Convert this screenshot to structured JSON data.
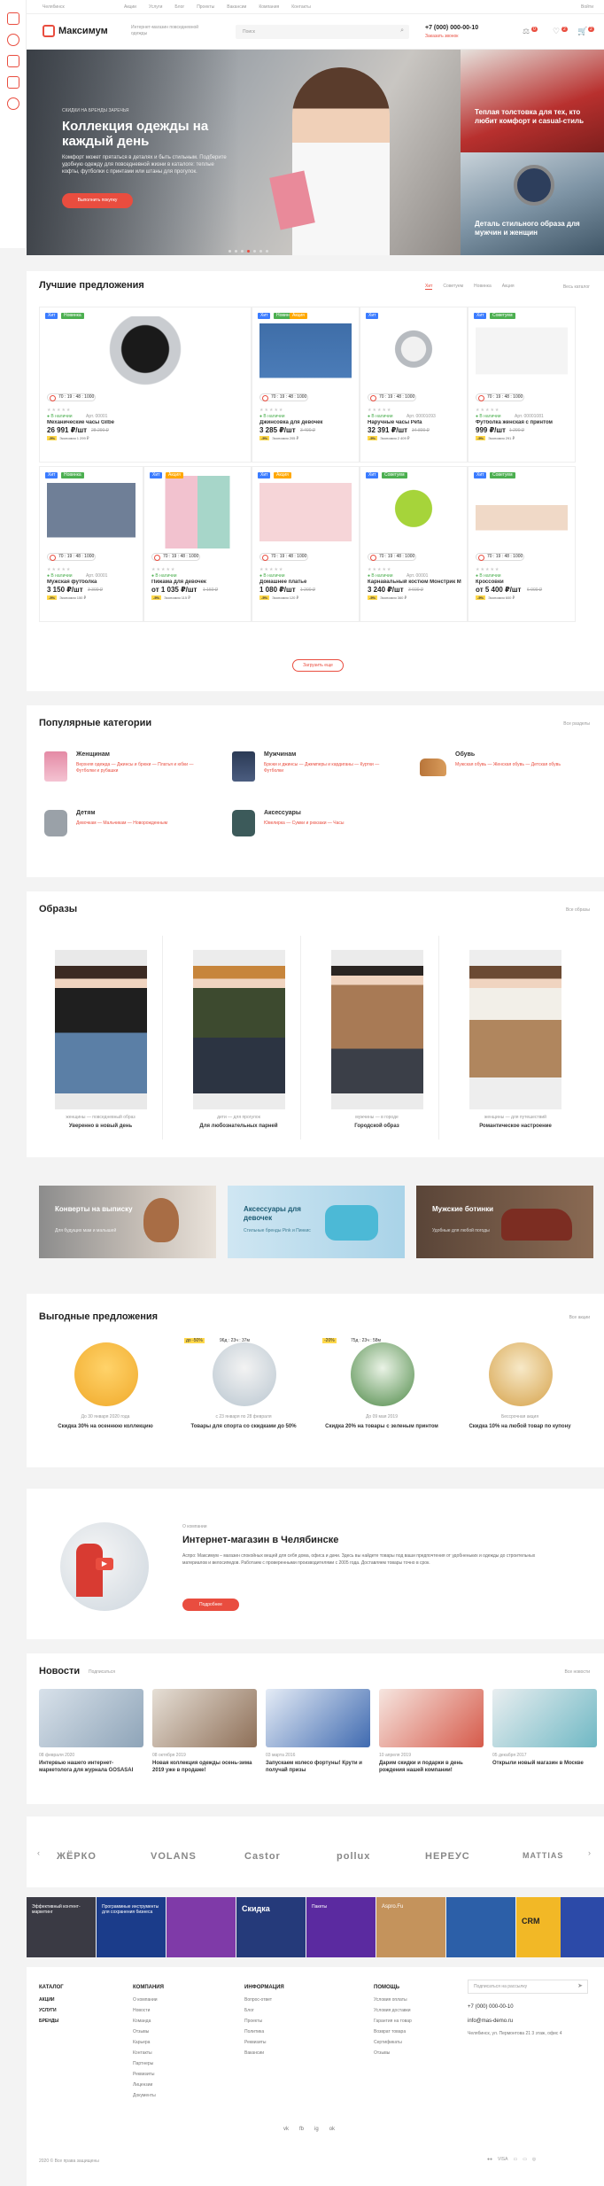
{
  "colors": {
    "accent": "#e94d3f",
    "background": "#f3f3f3",
    "panel": "#ffffff",
    "badge_hit": "#3b7cff",
    "badge_new": "#4caf50",
    "badge_advice": "#4caf50",
    "badge_sale": "#ffa800"
  },
  "topbar": {
    "city": "Челябинск",
    "links": [
      "Акции",
      "Услуги",
      "Блог",
      "Проекты",
      "Вакансии",
      "Компания",
      "Контакты"
    ],
    "login": "Войти"
  },
  "header": {
    "logo": "Максимум",
    "tagline": "Интернет-магазин повседневной одежды",
    "search_placeholder": "Поиск",
    "phone": "+7 (000) 000-00-10",
    "callback": "Заказать звонок",
    "cart_count": "2",
    "fav_count": "2",
    "compare_count": "0"
  },
  "hero": {
    "kicker": "СКИДКИ НА БРЕНДЫ ЗАРЕЧЬЯ",
    "title": "Коллекция одежды на каждый день",
    "text": "Комфорт может прятаться в деталях и быть стильным. Подберите удобную одежду для повседневной жизни в каталоге: теплые кофты, футболки с принтами или штаны для прогулок.",
    "button": "Выполнить покупку",
    "side1": "Теплая толстовка для тех, кто любит комфорт и casual-стиль",
    "side2": "Деталь стильного образа для мужчин и женщин"
  },
  "offers": {
    "title": "Лучшие предложения",
    "tabs": [
      "Хит",
      "Советуем",
      "Новинка",
      "Акция"
    ],
    "all": "Весь каталог",
    "more": "Загрузить еще",
    "products": [
      {
        "name": "Механические часы Gilbe",
        "price": "26 991 ₽/шт",
        "old": "28 290 ₽",
        "save": "1 299 ₽",
        "save_label": "Экономия",
        "badges": [
          "Хит",
          "Новинка"
        ],
        "timer": "70 : 19 : 48 : 1000",
        "stock": "В наличии",
        "art": "Арт. 00001"
      },
      {
        "name": "Джинсовка для девочек",
        "price": "3 285 ₽/шт",
        "old": "3 490 ₽",
        "save": "205 ₽",
        "save_label": "Экономия",
        "badges": [
          "Хит",
          "Новинка",
          "Акция"
        ],
        "timer": "70 : 19 : 48 : 1000",
        "stock": "В наличии",
        "art": ""
      },
      {
        "name": "Наручные часы Pefa",
        "price": "32 391 ₽/шт",
        "old": "34 800 ₽",
        "save": "2 409 ₽",
        "save_label": "Экономия",
        "badges": [
          "Хит"
        ],
        "timer": "70 : 19 : 48 : 1000",
        "stock": "В наличии",
        "art": "Арт. 00001093"
      },
      {
        "name": "Футболка женская с принтом",
        "price": "999 ₽/шт",
        "old": "1 290 ₽",
        "save": "291 ₽",
        "save_label": "Экономия",
        "badges": [
          "Хит",
          "Советуем"
        ],
        "timer": "70 : 19 : 48 : 1000",
        "stock": "В наличии",
        "art": "Арт. 00001081"
      },
      {
        "name": "Мужская футболка",
        "price": "3 150 ₽/шт",
        "old": "3 300 ₽",
        "save": "150 ₽",
        "save_label": "Экономия",
        "badges": [
          "Хит",
          "Новинка"
        ],
        "timer": "70 : 19 : 48 : 1000",
        "stock": "В наличии",
        "art": "Арт. 00001"
      },
      {
        "name": "Пижама для девочек",
        "price": "от 1 035 ₽/шт",
        "old": "1 150 ₽",
        "save": "115 ₽",
        "save_label": "Экономия",
        "badges": [
          "Хит",
          "Акция"
        ],
        "timer": "70 : 19 : 48 : 1000",
        "stock": "В наличии",
        "art": ""
      },
      {
        "name": "Домашнее платье",
        "price": "1 080 ₽/шт",
        "old": "1 200 ₽",
        "save": "120 ₽",
        "save_label": "Экономия",
        "badges": [
          "Хит",
          "Акция"
        ],
        "timer": "70 : 19 : 48 : 1000",
        "stock": "В наличии",
        "art": ""
      },
      {
        "name": "Карнавальный костюм Монстрик Майк",
        "price": "3 240 ₽/шт",
        "old": "3 600 ₽",
        "save": "360 ₽",
        "save_label": "Экономия",
        "badges": [
          "Хит",
          "Советуем"
        ],
        "timer": "70 : 19 : 48 : 1000",
        "stock": "В наличии",
        "art": "Арт. 00001"
      },
      {
        "name": "Кроссовки",
        "price": "от 5 400 ₽/шт",
        "old": "6 000 ₽",
        "save": "600 ₽",
        "save_label": "Экономия",
        "badges": [
          "Хит",
          "Советуем"
        ],
        "timer": "70 : 19 : 48 : 1000",
        "stock": "В наличии",
        "art": ""
      }
    ]
  },
  "categories": {
    "title": "Популярные категории",
    "all": "Все разделы",
    "items": [
      {
        "name": "Женщинам",
        "links": "Верхняя одежда — Джинсы и брюки — Платья и юбки — Футболки и рубашки"
      },
      {
        "name": "Мужчинам",
        "links": "Брюки и джинсы — Джемперы и кардиганы — Куртки — Футболки"
      },
      {
        "name": "Обувь",
        "links": "Мужская обувь — Женская обувь — Детская обувь"
      },
      {
        "name": "Детям",
        "links": "Девочкам — Мальчикам — Новорожденным"
      },
      {
        "name": "Аксессуары",
        "links": "Ювелирка — Сумки и рюкзаки — Часы"
      }
    ]
  },
  "outfits": {
    "title": "Образы",
    "all": "Все образы",
    "items": [
      {
        "tag": "женщины — повседневный образ",
        "name": "Уверенно в новый день"
      },
      {
        "tag": "дети — для прогулок",
        "name": "Для любознательных парней"
      },
      {
        "tag": "мужчины — в городе",
        "name": "Городской образ"
      },
      {
        "tag": "женщины — для путешествий",
        "name": "Романтическое настроение"
      }
    ]
  },
  "banners": [
    {
      "title": "Конверты на выписку",
      "sub": "Для будущих мам и малышей"
    },
    {
      "title": "Аксессуары для девочек",
      "sub": "Стильные бренды Pink и Пинкис"
    },
    {
      "title": "Мужские ботинки",
      "sub": "Удобные для любой погоды"
    }
  ],
  "deals": {
    "title": "Выгодные предложения",
    "all": "Все акции",
    "items": [
      {
        "date": "До 30 января 2020 года",
        "name": "Скидка 30% на осеннюю коллекцию",
        "tag": "",
        "timer": ""
      },
      {
        "date": "с 23 января по 28 февраля",
        "name": "Товары для спорта со скидками до 50%",
        "tag": "до -50%",
        "timer": "96д : 23ч : 37м"
      },
      {
        "date": "До 09 мая 2019",
        "name": "Скидка 20% на товары с зеленым принтом",
        "tag": "-20%",
        "timer": "75д : 23ч : 58м"
      },
      {
        "date": "Бессрочная акция",
        "name": "Скидка 10% на любой товар по купону",
        "tag": "",
        "timer": ""
      }
    ]
  },
  "about": {
    "kicker": "О компании",
    "title": "Интернет-магазин в Челябинске",
    "text": "Аспро: Максимум – магазин спокойных вещей для себя дома, офиса и дачи. Здесь вы найдете товары под ваши предпочтения от удобненьких и одежды до строительных материалов и велосипедов. Работаем с проверенными производителями с 2005 года. Доставляем товары точно в срок.",
    "button": "Подробнее"
  },
  "news": {
    "title": "Новости",
    "subscribe": "Подписаться",
    "all": "Все новости",
    "items": [
      {
        "date": "08 февраля 2020",
        "title": "Интервью нашего интернет-маркетолога для журнала GOSASAI"
      },
      {
        "date": "08 октября 2019",
        "title": "Новая коллекция одежды осень-зима 2019 уже в продаже!"
      },
      {
        "date": "03 марта 2016",
        "title": "Запускаем колесо фортуны! Крути и получай призы"
      },
      {
        "date": "10 апреля 2019",
        "title": "Дарим скидки и подарки в день рождения нашей компании!"
      },
      {
        "date": "05 декабря 2017",
        "title": "Открыли новый магазин в Москве"
      }
    ]
  },
  "brands": [
    "ЖЁРКО",
    "VOLANS",
    "Castor",
    "pollux",
    "НЕРЕУС",
    "MATTIAS"
  ],
  "promo_tiles": [
    {
      "text": "Эффективный контент-маркетинг"
    },
    {
      "text": "Программные инструменты для сохранения бизнеса"
    },
    {
      "text": ""
    },
    {
      "text": "Скидка"
    },
    {
      "text": "Пакеты"
    },
    {
      "text": "Aspro.Fu"
    },
    {
      "text": ""
    },
    {
      "text": "CRM"
    },
    {
      "text": ""
    }
  ],
  "footer": {
    "col1": {
      "title": "КАТАЛОГ",
      "items": [
        "АКЦИИ",
        "УСЛУГИ",
        "БРЕНДЫ"
      ]
    },
    "col2": {
      "title": "КОМПАНИЯ",
      "items": [
        "О компании",
        "Новости",
        "Команда",
        "Отзывы",
        "Карьера",
        "Контакты",
        "Партнеры",
        "Реквизиты",
        "Лицензии",
        "Документы"
      ]
    },
    "col3": {
      "title": "ИНФОРМАЦИЯ",
      "items": [
        "Вопрос-ответ",
        "Блог",
        "Проекты",
        "Политика",
        "Реквизиты",
        "Вакансии"
      ]
    },
    "col4": {
      "title": "ПОМОЩЬ",
      "items": [
        "Условия оплаты",
        "Условия доставки",
        "Гарантия на товар",
        "Возврат товара",
        "Сертификаты",
        "Отзывы"
      ]
    },
    "subscribe": "Подписаться на рассылку",
    "phone": "+7 (000) 000-00-10",
    "email": "info@mas-demo.ru",
    "address": "Челябинск, ул. Пермонтова 21 3 этаж, офис 4",
    "copyright": "2020 © Все права защищены",
    "socials": [
      "vk",
      "fb",
      "ig",
      "ok"
    ]
  }
}
